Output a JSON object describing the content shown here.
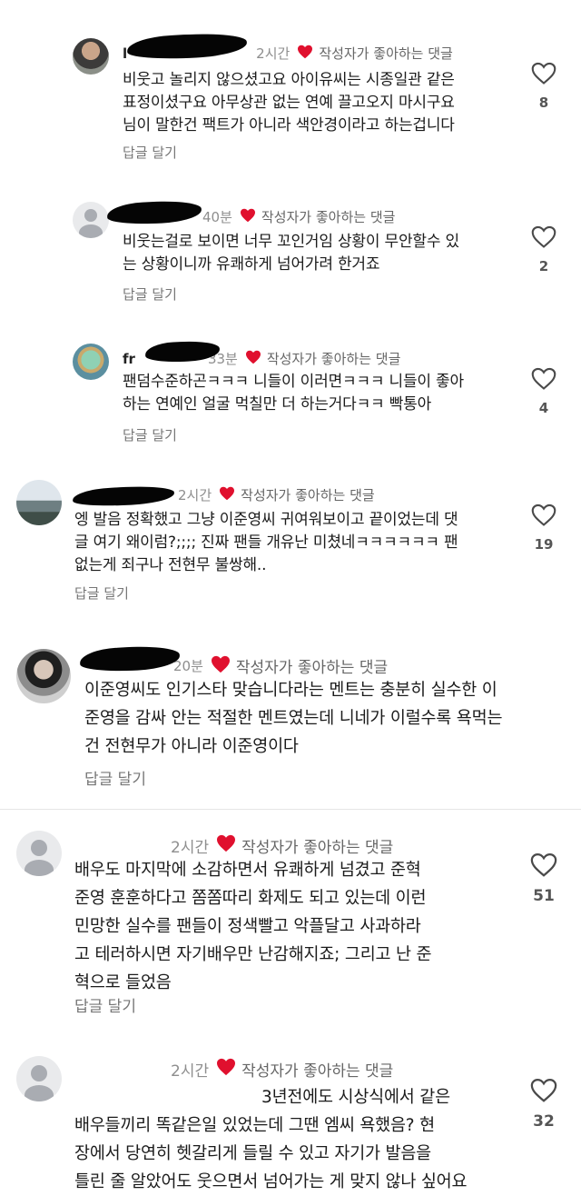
{
  "liked_by_author_label": "작성자가 좋아하는 댓글",
  "reply_label": "답글 달기",
  "comments": [
    {
      "username": "l",
      "time": "2시간",
      "lines": [
        "비웃고 놀리지 않으셨고요 아이유씨는 시종일관 같은",
        "표정이셨구요 아무상관 없는 연예 끌고오지 마시구요",
        "님이 말한건 팩트가 아니라 색안경이라고 하는겁니다"
      ],
      "likes": "8"
    },
    {
      "username": "",
      "time": "40분",
      "lines": [
        "비웃는걸로 보이면 너무 꼬인거임 상황이 무안할수 있",
        "는 상황이니까 유쾌하게 넘어가려 한거죠"
      ],
      "likes": "2"
    },
    {
      "username": "fr",
      "time": "33분",
      "lines": [
        "팬덤수준하곤ㅋㅋㅋ 니들이 이러면ㅋㅋㅋ 니들이 좋아",
        "하는 연예인 얼굴 먹칠만 더 하는거다ㅋㅋ 빡통아"
      ],
      "likes": "4"
    },
    {
      "username": "",
      "time": "2시간",
      "lines": [
        "엥 발음 정확했고 그냥 이준영씨 귀여워보이고 끝이었는데 댓",
        "글 여기 왜이럼?;;;; 진짜 팬들 개유난 미쳤네ㅋㅋㅋㅋㅋㅋ 팬",
        "없는게 죄구나 전현무 불쌍해.."
      ],
      "likes": "19"
    },
    {
      "username": "",
      "time": "20분",
      "lines": [
        "이준영씨도 인기스타 맞습니다라는 멘트는 충분히 실수한 이",
        "준영을 감싸 안는 적절한 멘트였는데 니네가 이럴수록 욕먹는",
        "건 전현무가 아니라 이준영이다"
      ],
      "likes": ""
    },
    {
      "username": "",
      "time": "2시간",
      "lines": [
        "배우도 마지막에 소감하면서 유쾌하게 넘겼고 준혁",
        "준영 훈훈하다고 쫌쫌따리 화제도 되고 있는데 이런",
        "민망한 실수를 팬들이 정색빨고 악플달고 사과하라",
        "고 테러하시면 자기배우만 난감해지죠; 그리고 난 준",
        "혁으로 들었음"
      ],
      "likes": "51"
    },
    {
      "username": "",
      "time": "2시간",
      "lines": [
        "3년전에도 시상식에서 같은",
        "배우들끼리 똑같은일 있었는데 그땐 엠씨 욕했음? 현",
        "장에서 당연히 헷갈리게 들릴 수 있고 자기가 발음을",
        "틀린 줄 알았어도 웃으면서 넘어가는 게 맞지 않나 싶어요"
      ],
      "likes": "32"
    }
  ],
  "icons": {
    "like": "heart-outline-icon",
    "liked_by_author": "heart-filled-icon",
    "accent": "#e0102e"
  }
}
